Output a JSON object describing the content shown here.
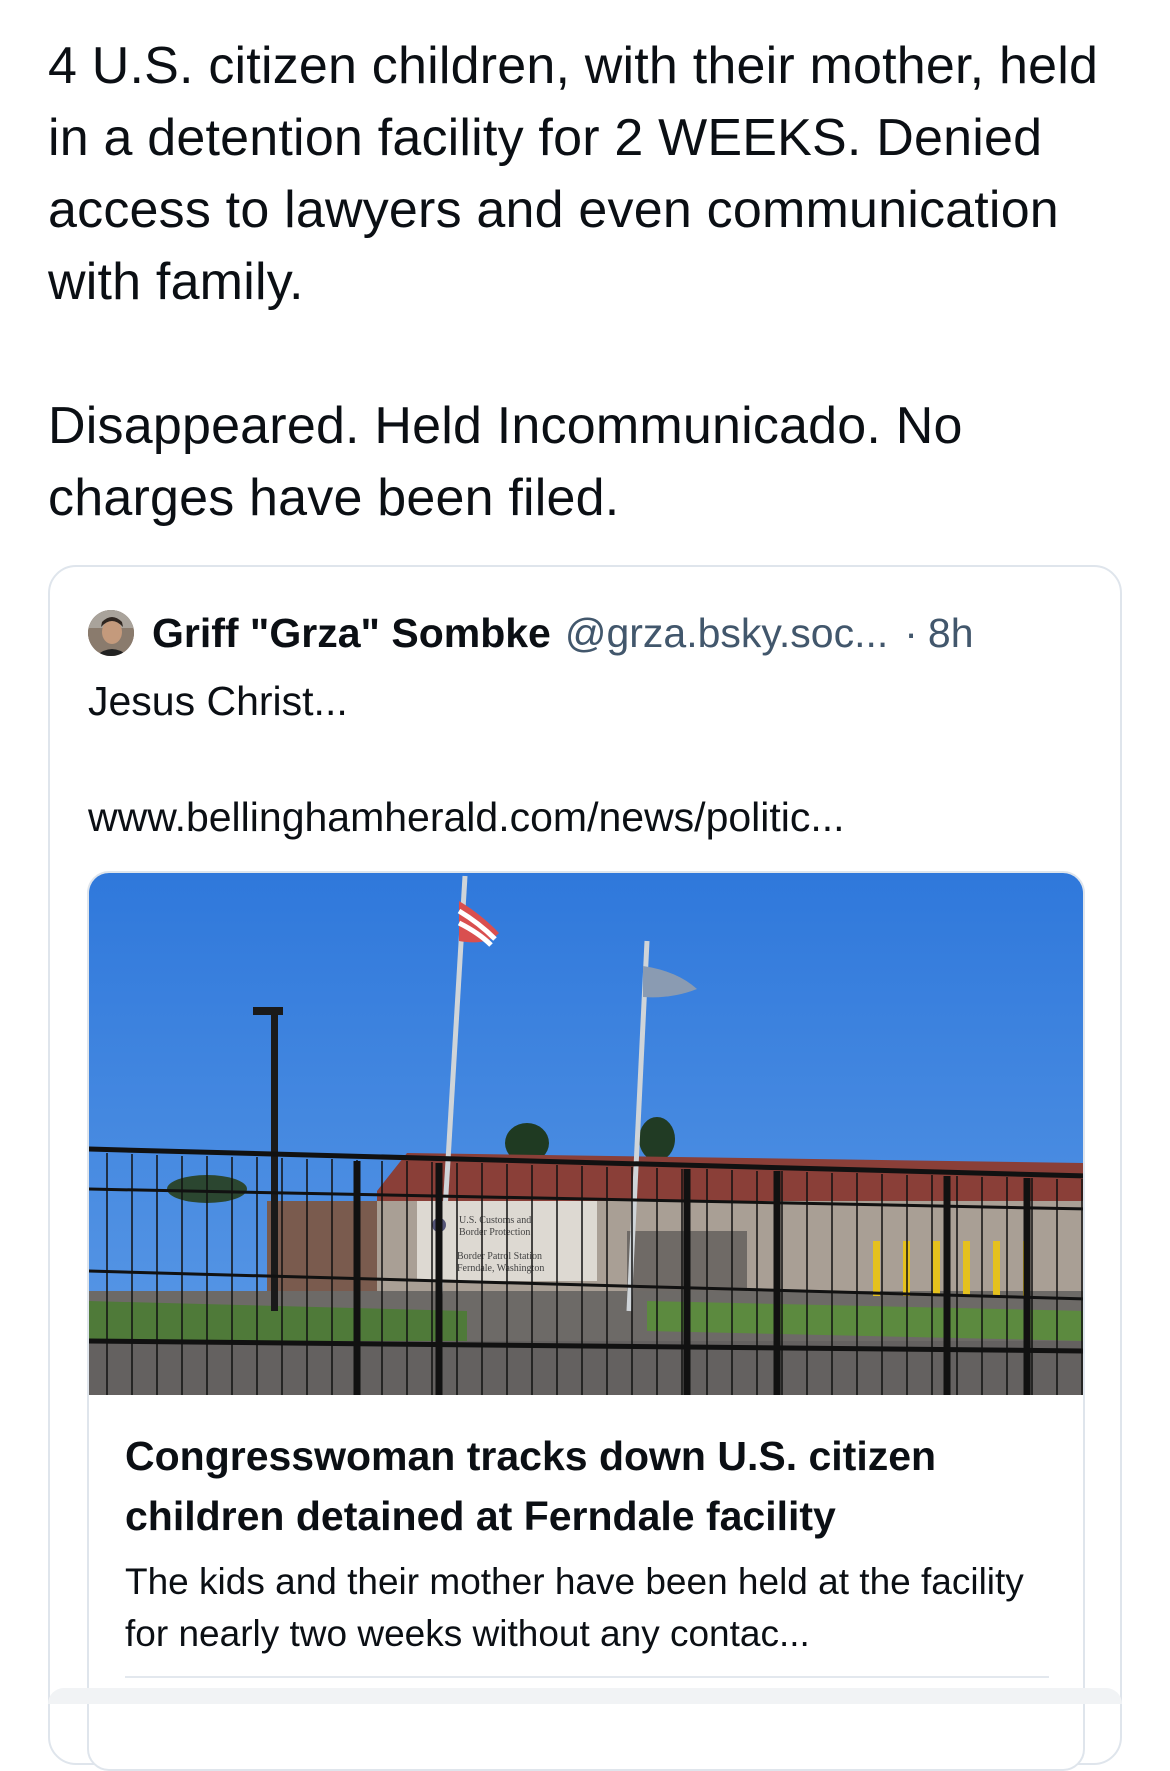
{
  "post": {
    "text": "4 U.S. citizen children, with their mother, held in a detention facility for 2 WEEKS. Denied access to lawyers and even communication with family.\n\nDisappeared. Held Incommunicado. No charges have been filed."
  },
  "quoted_post": {
    "author_name": "Griff \"Grza\" Sombke",
    "author_handle": "@grza.bsky.soc...",
    "separator": "·",
    "time": "8h",
    "text": "Jesus Christ...\n\nwww.bellinghamherald.com/news/politic...",
    "link_card": {
      "image_sign_text": [
        "U.S. Customs and",
        "Border Protection",
        "Border Patrol Station",
        "Ferndale, Washington"
      ],
      "title": "Congresswoman tracks down U.S. citizen children detained at Ferndale facility",
      "description": "The kids and their mother have been held at the facility for nearly two weeks without any contac..."
    }
  },
  "colors": {
    "text": "#0b0f14",
    "secondary_text": "#42576c",
    "border": "#dfe5ec",
    "sky": "#3f84df"
  },
  "icons": {
    "avatar": "user-avatar"
  }
}
